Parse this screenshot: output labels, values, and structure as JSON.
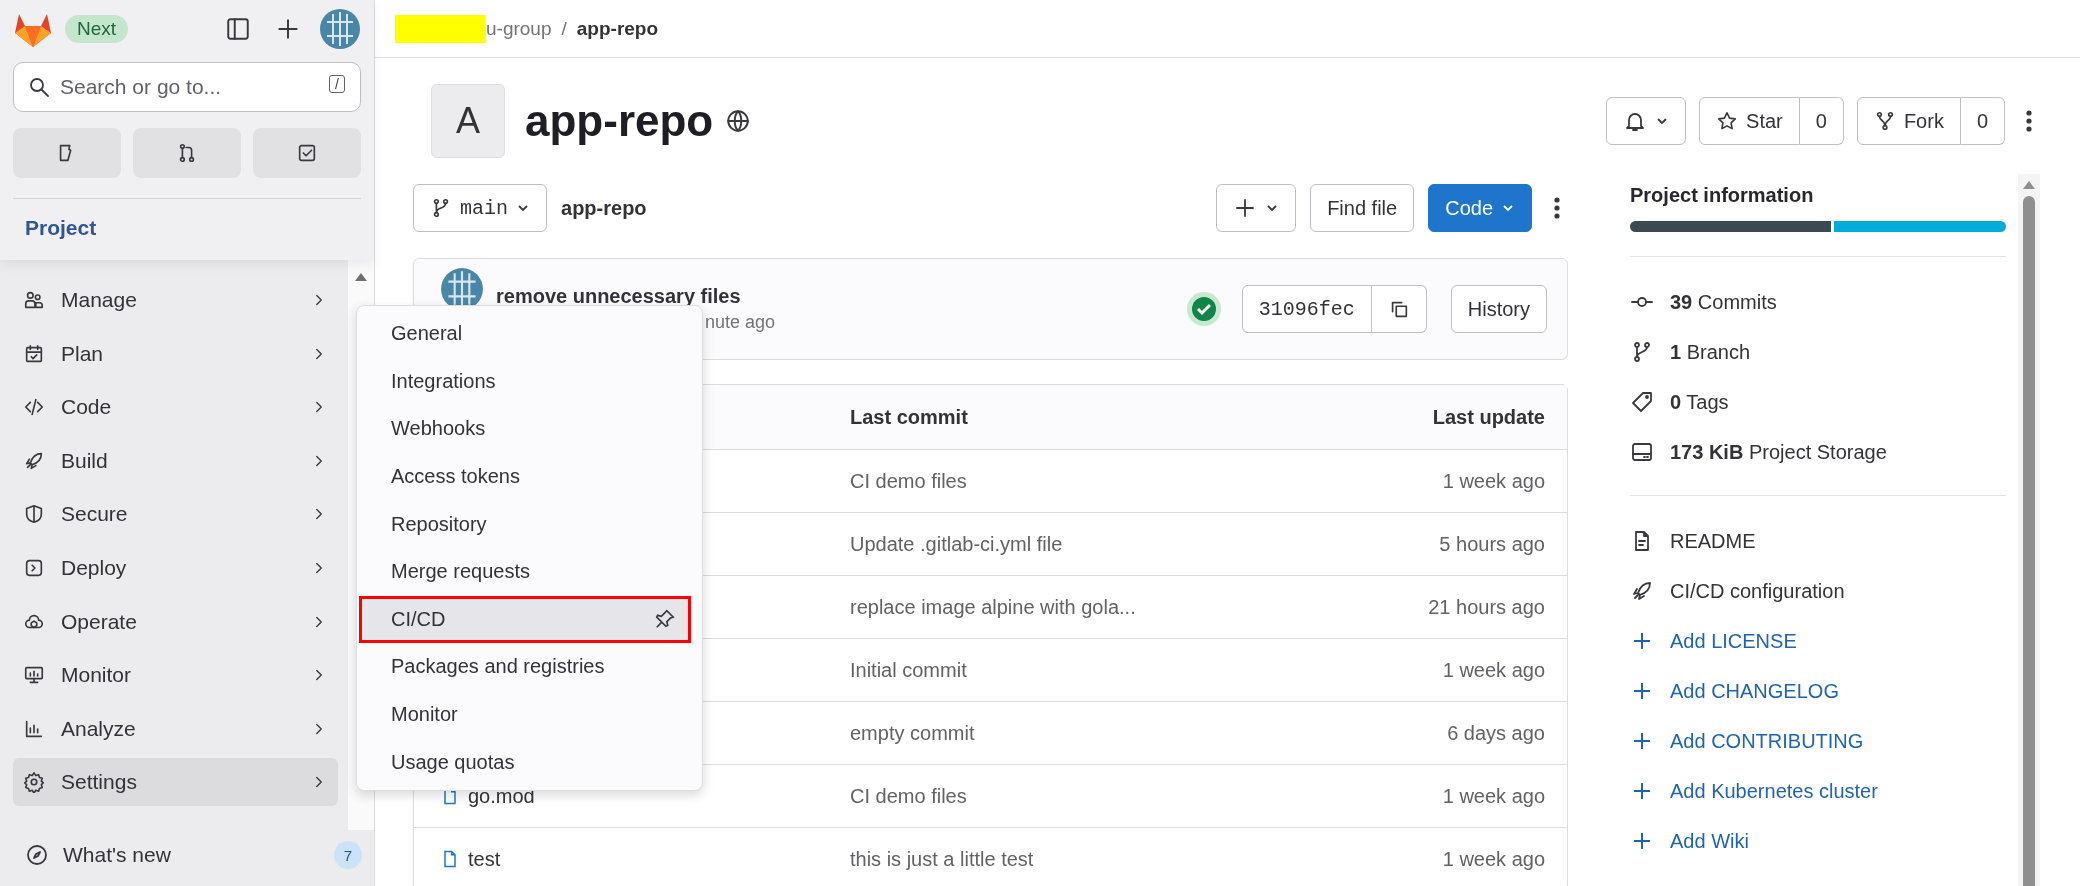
{
  "top_bar": {
    "badge": "Next"
  },
  "search": {
    "placeholder": "Search or go to...",
    "shortcut": "/"
  },
  "sidebar": {
    "section": "Project",
    "items": [
      {
        "label": "Manage",
        "selected": false
      },
      {
        "label": "Plan",
        "selected": false
      },
      {
        "label": "Code",
        "selected": false
      },
      {
        "label": "Build",
        "selected": false
      },
      {
        "label": "Secure",
        "selected": false
      },
      {
        "label": "Deploy",
        "selected": false
      },
      {
        "label": "Operate",
        "selected": false
      },
      {
        "label": "Monitor",
        "selected": false
      },
      {
        "label": "Analyze",
        "selected": false
      },
      {
        "label": "Settings",
        "selected": true
      }
    ],
    "whats_new": {
      "label": "What's new",
      "count": "7"
    }
  },
  "breadcrumb": {
    "group": "u-group",
    "separator": "/",
    "current": "app-repo"
  },
  "project": {
    "avatar_letter": "A",
    "name": "app-repo",
    "star_label": "Star",
    "star_count": "0",
    "fork_label": "Fork",
    "fork_count": "0"
  },
  "repo_bar": {
    "branch": "main",
    "path": "app-repo",
    "find_file": "Find file",
    "code": "Code"
  },
  "last_commit": {
    "message": "remove unnecessary files",
    "time": "nute ago",
    "pipeline_passed": true,
    "sha": "31096fec",
    "history": "History"
  },
  "settings_menu": {
    "items": [
      {
        "label": "General",
        "selected": false,
        "outlined": false
      },
      {
        "label": "Integrations",
        "selected": false,
        "outlined": false
      },
      {
        "label": "Webhooks",
        "selected": false,
        "outlined": false
      },
      {
        "label": "Access tokens",
        "selected": false,
        "outlined": false
      },
      {
        "label": "Repository",
        "selected": false,
        "outlined": false
      },
      {
        "label": "Merge requests",
        "selected": false,
        "outlined": false
      },
      {
        "label": "CI/CD",
        "selected": true,
        "outlined": true
      },
      {
        "label": "Packages and registries",
        "selected": false,
        "outlined": false
      },
      {
        "label": "Monitor",
        "selected": false,
        "outlined": false
      },
      {
        "label": "Usage quotas",
        "selected": false,
        "outlined": false
      }
    ]
  },
  "files": {
    "columns": [
      "Last commit",
      "Last update"
    ],
    "rows": [
      {
        "commit": "CI demo files",
        "updated": "1 week ago"
      },
      {
        "commit": "Update .gitlab-ci.yml file",
        "updated": "5 hours ago"
      },
      {
        "commit": "replace image alpine with gola...",
        "updated": "21 hours ago"
      },
      {
        "commit": "Initial commit",
        "updated": "1 week ago"
      },
      {
        "commit": "empty commit",
        "updated": "6 days ago"
      },
      {
        "name": "go.mod",
        "commit": "CI demo files",
        "updated": "1 week ago"
      },
      {
        "name": "test",
        "commit": "this is just a little test",
        "updated": "1 week ago"
      }
    ]
  },
  "project_info": {
    "title": "Project information",
    "stats": [
      {
        "count": "39",
        "label": "Commits"
      },
      {
        "count": "1",
        "label": "Branch"
      },
      {
        "count": "0",
        "label": "Tags"
      },
      {
        "count": "173 KiB",
        "label": "Project Storage"
      }
    ],
    "files": [
      "README",
      "CI/CD configuration"
    ],
    "add_links": [
      "Add LICENSE",
      "Add CHANGELOG",
      "Add CONTRIBUTING",
      "Add Kubernetes cluster",
      "Add Wiki"
    ]
  }
}
